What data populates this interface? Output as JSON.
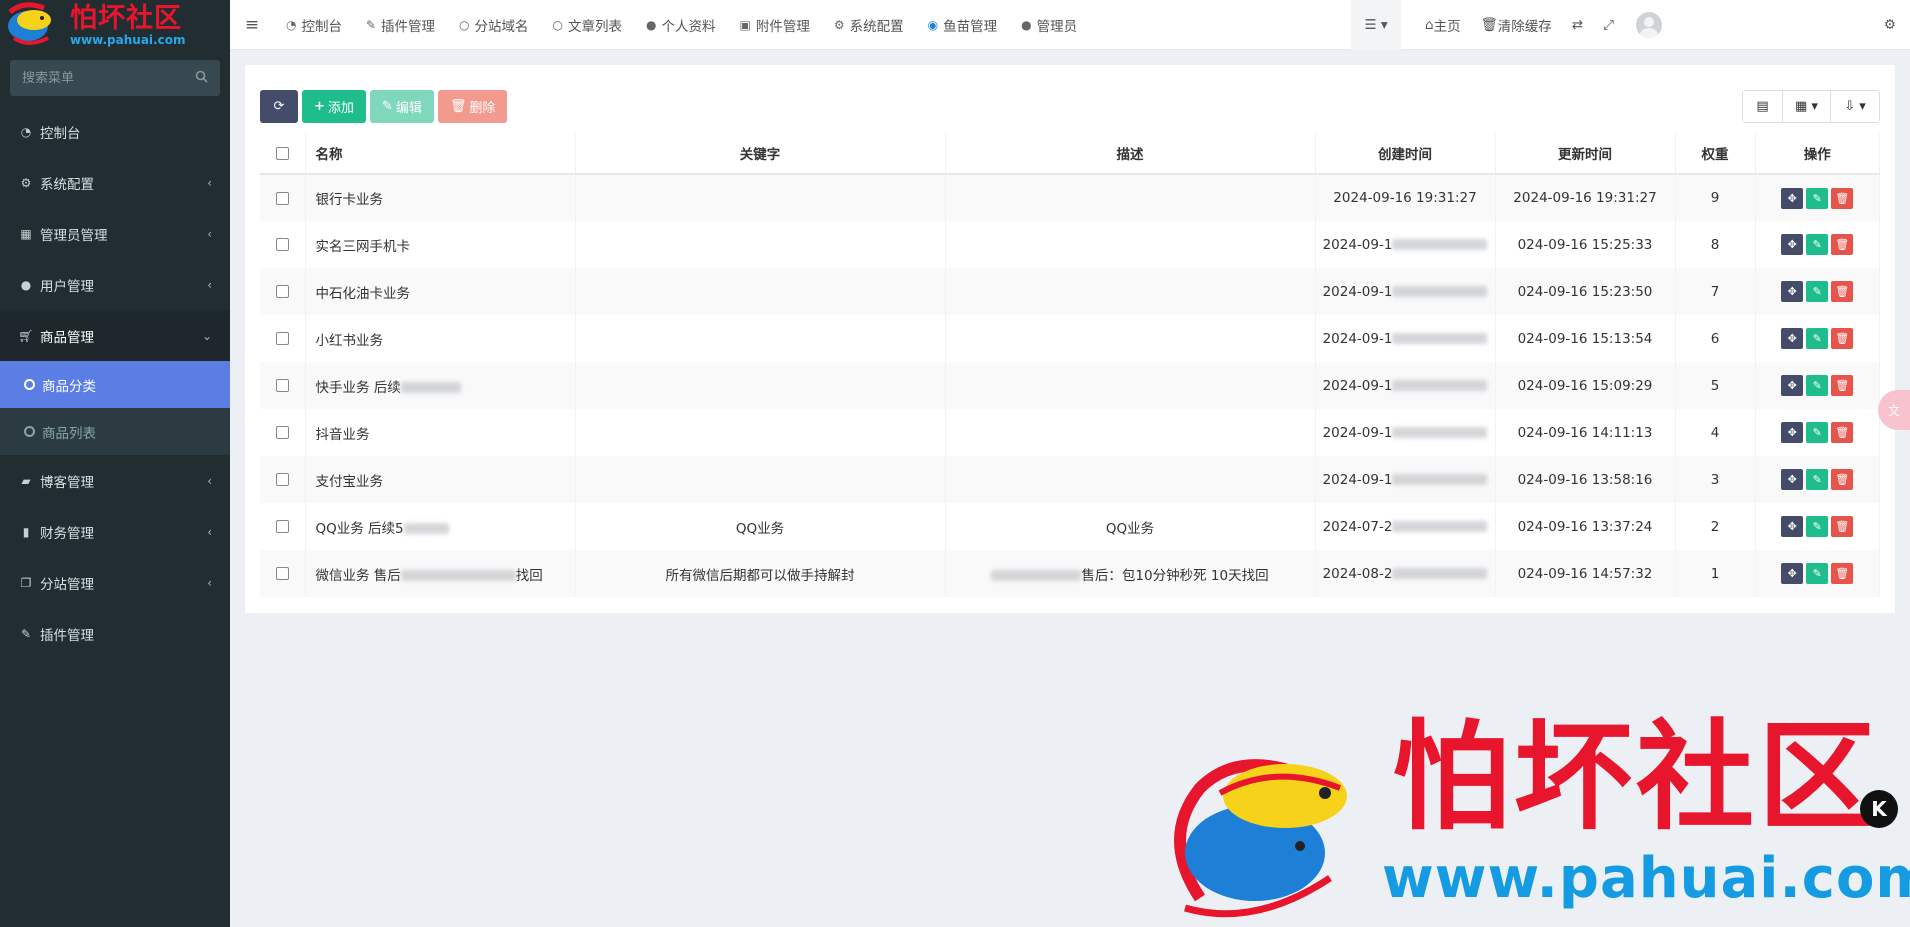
{
  "logo": {
    "text": "怕坏社区",
    "url": "www.pahuai.com"
  },
  "search": {
    "placeholder": "搜索菜单"
  },
  "sidebar": {
    "items": [
      {
        "label": "控制台",
        "icon": "dashboard-icon"
      },
      {
        "label": "系统配置",
        "icon": "gears-icon"
      },
      {
        "label": "管理员管理",
        "icon": "windows-icon"
      },
      {
        "label": "用户管理",
        "icon": "user-icon"
      },
      {
        "label": "商品管理",
        "icon": "cart-icon"
      },
      {
        "label": "博客管理",
        "icon": "book-icon"
      },
      {
        "label": "财务管理",
        "icon": "bookmark-icon"
      },
      {
        "label": "分站管理",
        "icon": "clone-icon"
      },
      {
        "label": "插件管理",
        "icon": "plug-icon"
      }
    ],
    "sub": [
      {
        "label": "商品分类"
      },
      {
        "label": "商品列表"
      }
    ]
  },
  "nav": {
    "items": [
      {
        "label": "控制台"
      },
      {
        "label": "插件管理"
      },
      {
        "label": "分站域名"
      },
      {
        "label": "文章列表"
      },
      {
        "label": "个人资料"
      },
      {
        "label": "附件管理"
      },
      {
        "label": "系统配置"
      },
      {
        "label": "鱼苗管理"
      },
      {
        "label": "管理员"
      }
    ],
    "home": "主页",
    "clear_cache": "清除缓存"
  },
  "toolbar": {
    "add": "添加",
    "edit": "编辑",
    "delete": "删除"
  },
  "table": {
    "headers": {
      "name": "名称",
      "keyword": "关键字",
      "desc": "描述",
      "created": "创建时间",
      "updated": "更新时间",
      "weight": "权重",
      "ops": "操作"
    },
    "rows": [
      {
        "name": "银行卡业务",
        "keyword": "",
        "desc": "",
        "created": "2024-09-16 19:31:27",
        "updated": "2024-09-16 19:31:27",
        "weight": "9"
      },
      {
        "name": "实名三网手机卡",
        "keyword": "",
        "desc": "",
        "created": "2024-09-1",
        "updated": "024-09-16 15:25:33",
        "weight": "8"
      },
      {
        "name": "中石化油卡业务",
        "keyword": "",
        "desc": "",
        "created": "2024-09-1",
        "updated": "024-09-16 15:23:50",
        "weight": "7"
      },
      {
        "name": "小红书业务",
        "keyword": "",
        "desc": "",
        "created": "2024-09-1",
        "updated": "024-09-16 15:13:54",
        "weight": "6"
      },
      {
        "name": "快手业务 后续",
        "keyword": "",
        "desc": "",
        "created": "2024-09-1",
        "updated": "024-09-16 15:09:29",
        "weight": "5"
      },
      {
        "name": "抖音业务",
        "keyword": "",
        "desc": "",
        "created": "2024-09-1",
        "updated": "024-09-16 14:11:13",
        "weight": "4"
      },
      {
        "name": "支付宝业务",
        "keyword": "",
        "desc": "",
        "created": "2024-09-1",
        "updated": "024-09-16 13:58:16",
        "weight": "3"
      },
      {
        "name": "QQ业务 后续5",
        "keyword": "QQ业务",
        "desc": "QQ业务",
        "created": "2024-07-2",
        "updated": "024-09-16 13:37:24",
        "weight": "2"
      },
      {
        "name": "微信业务 售后",
        "name_tail": "找回",
        "keyword": "所有微信后期都可以做手持解封",
        "desc": "售后：包10分钟秒死 10天找回",
        "created": "2024-08-2",
        "updated": "024-09-16 14:57:32",
        "weight": "1"
      }
    ]
  },
  "watermark": {
    "text": "怕坏社区",
    "url": "www.pahuai.com",
    "badge": "K"
  },
  "colors": {
    "sidebar": "#222d32",
    "active": "#5b7ee5",
    "green": "#1fbc8c",
    "red": "#e5554b",
    "navy": "#444c69"
  }
}
